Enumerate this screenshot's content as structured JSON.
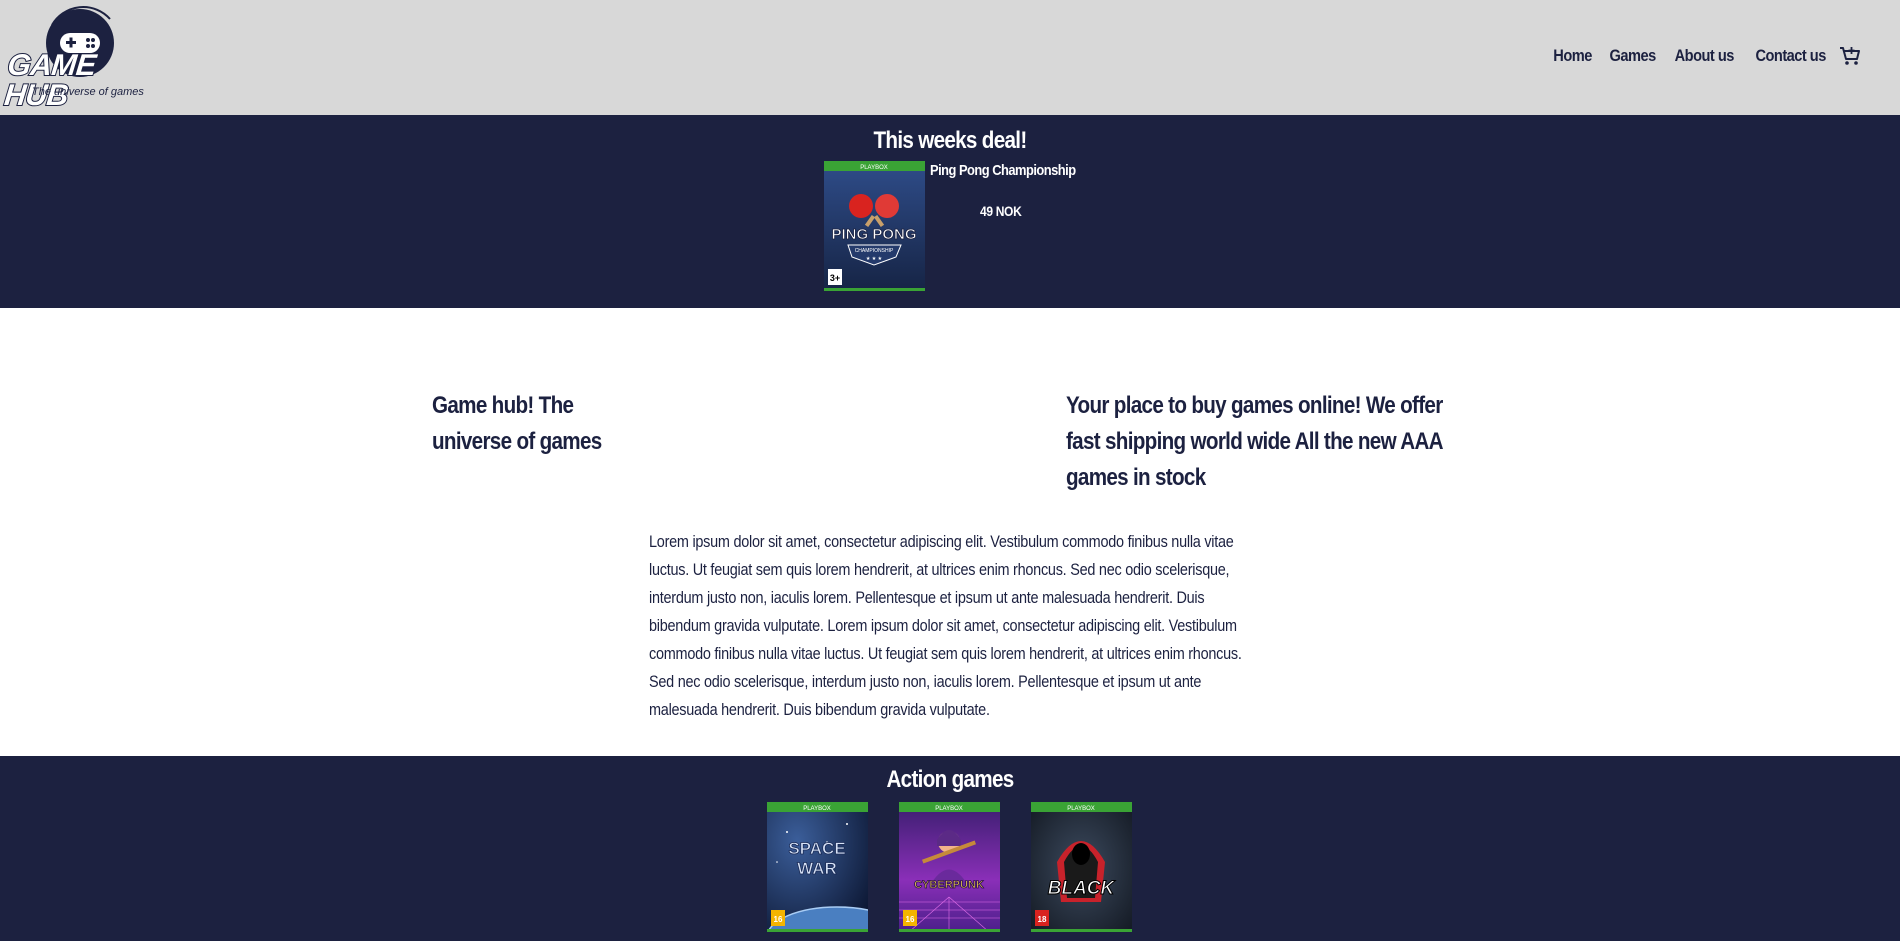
{
  "header": {
    "logo_text": "GAME HUB",
    "logo_tagline": "The universe of games",
    "nav": [
      "Home",
      "Games",
      "About us",
      "Contact us"
    ],
    "cart_icon": "cart-icon"
  },
  "deal": {
    "title": "This weeks deal!",
    "product": {
      "name": "Ping Pong Championship",
      "price": "49 NOK",
      "cover_platform": "PLAYBOX",
      "cover_title_line1": "PING PONG",
      "cover_subtitle": "CHAMPIONSHIP",
      "age_rating": "3+"
    }
  },
  "intro": {
    "heading_left": "Game hub! The universe of games",
    "heading_right": "Your place to buy games online! We offer fast shipping world wide All the new AAA games in stock",
    "body": "Lorem ipsum dolor sit amet, consectetur adipiscing elit. Vestibulum commodo finibus nulla vitae luctus. Ut feugiat sem quis lorem hendrerit, at ultrices enim rhoncus. Sed nec odio scelerisque, interdum justo non, iaculis lorem. Pellentesque et ipsum ut ante malesuada hendrerit. Duis bibendum gravida vulputate. Lorem ipsum dolor sit amet, consectetur adipiscing elit. Vestibulum commodo finibus nulla vitae luctus. Ut feugiat sem quis lorem hendrerit, at ultrices enim rhoncus. Sed nec odio scelerisque, interdum justo non, iaculis lorem. Pellentesque et ipsum ut ante malesuada hendrerit. Duis bibendum gravida vulputate."
  },
  "action_games": {
    "title": "Action games",
    "games": [
      {
        "cover_title": "SPACE WAR",
        "platform": "PLAYBOX",
        "age_rating": "16"
      },
      {
        "cover_title": "CYBERPUNK",
        "platform": "PLAYBOX",
        "age_rating": "16"
      },
      {
        "cover_title": "BLACK",
        "platform": "PLAYBOX",
        "age_rating": "18"
      }
    ]
  },
  "colors": {
    "navy": "#1c2140",
    "header_bg": "#d8d8d8",
    "platform_green": "#3aa335",
    "white": "#ffffff"
  }
}
